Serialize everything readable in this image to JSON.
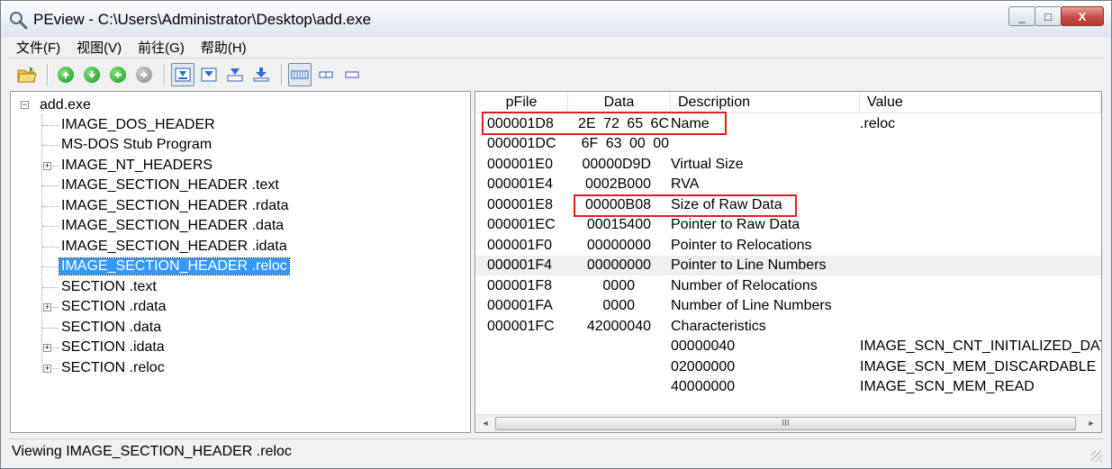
{
  "window": {
    "title": "PEview - C:\\Users\\Administrator\\Desktop\\add.exe",
    "controls": {
      "minimize": "_",
      "maximize": "□",
      "close": "X"
    }
  },
  "menu": [
    "文件(F)",
    "视图(V)",
    "前往(G)",
    "帮助(H)"
  ],
  "toolbar": {
    "icons": [
      "open-icon",
      "up-icon",
      "down-icon",
      "back-icon",
      "forward-icon",
      "view-1-icon",
      "view-2-icon",
      "view-3-icon",
      "view-4-icon",
      "byte-view-icon",
      "word-view-icon",
      "dword-view-icon"
    ]
  },
  "tree": {
    "root": "add.exe",
    "items": [
      {
        "label": "IMAGE_DOS_HEADER",
        "expandable": false,
        "selected": false
      },
      {
        "label": "MS-DOS Stub Program",
        "expandable": false,
        "selected": false
      },
      {
        "label": "IMAGE_NT_HEADERS",
        "expandable": true,
        "selected": false
      },
      {
        "label": "IMAGE_SECTION_HEADER .text",
        "expandable": false,
        "selected": false
      },
      {
        "label": "IMAGE_SECTION_HEADER .rdata",
        "expandable": false,
        "selected": false
      },
      {
        "label": "IMAGE_SECTION_HEADER .data",
        "expandable": false,
        "selected": false
      },
      {
        "label": "IMAGE_SECTION_HEADER .idata",
        "expandable": false,
        "selected": false
      },
      {
        "label": "IMAGE_SECTION_HEADER .reloc",
        "expandable": false,
        "selected": true
      },
      {
        "label": "SECTION .text",
        "expandable": false,
        "selected": false
      },
      {
        "label": "SECTION .rdata",
        "expandable": true,
        "selected": false
      },
      {
        "label": "SECTION .data",
        "expandable": false,
        "selected": false
      },
      {
        "label": "SECTION .idata",
        "expandable": true,
        "selected": false
      },
      {
        "label": "SECTION .reloc",
        "expandable": true,
        "selected": false
      }
    ]
  },
  "table": {
    "columns": [
      "pFile",
      "Data",
      "Description",
      "Value"
    ],
    "rows": [
      {
        "pfile": "000001D8",
        "data": "2E 72 65 6C",
        "desc": "Name",
        "value": ".reloc"
      },
      {
        "pfile": "000001DC",
        "data": "6F 63 00 00",
        "desc": "",
        "value": ""
      },
      {
        "pfile": "000001E0",
        "data": "00000D9D",
        "desc": "Virtual Size",
        "value": ""
      },
      {
        "pfile": "000001E4",
        "data": "0002B000",
        "desc": "RVA",
        "value": ""
      },
      {
        "pfile": "000001E8",
        "data": "00000B08",
        "desc": "Size of Raw Data",
        "value": ""
      },
      {
        "pfile": "000001EC",
        "data": "00015400",
        "desc": "Pointer to Raw Data",
        "value": ""
      },
      {
        "pfile": "000001F0",
        "data": "00000000",
        "desc": "Pointer to Relocations",
        "value": ""
      },
      {
        "pfile": "000001F4",
        "data": "00000000",
        "desc": "Pointer to Line Numbers",
        "value": "",
        "highlight": true
      },
      {
        "pfile": "000001F8",
        "data": "0000",
        "desc": "Number of Relocations",
        "value": ""
      },
      {
        "pfile": "000001FA",
        "data": "0000",
        "desc": "Number of Line Numbers",
        "value": ""
      },
      {
        "pfile": "000001FC",
        "data": "42000040",
        "desc": "Characteristics",
        "value": ""
      },
      {
        "pfile": "",
        "data": "",
        "desc": "00000040",
        "value": "IMAGE_SCN_CNT_INITIALIZED_DAT"
      },
      {
        "pfile": "",
        "data": "",
        "desc": "02000000",
        "value": "IMAGE_SCN_MEM_DISCARDABLE"
      },
      {
        "pfile": "",
        "data": "",
        "desc": "40000000",
        "value": "IMAGE_SCN_MEM_READ"
      }
    ],
    "scrollbar": {
      "left_arrow": "◂",
      "right_arrow": "▸",
      "thumb_grip": "III"
    }
  },
  "status": "Viewing IMAGE_SECTION_HEADER .reloc",
  "colors": {
    "selection": "#3399ff",
    "annotation": "#e02020",
    "row_highlight": "#efefef"
  }
}
